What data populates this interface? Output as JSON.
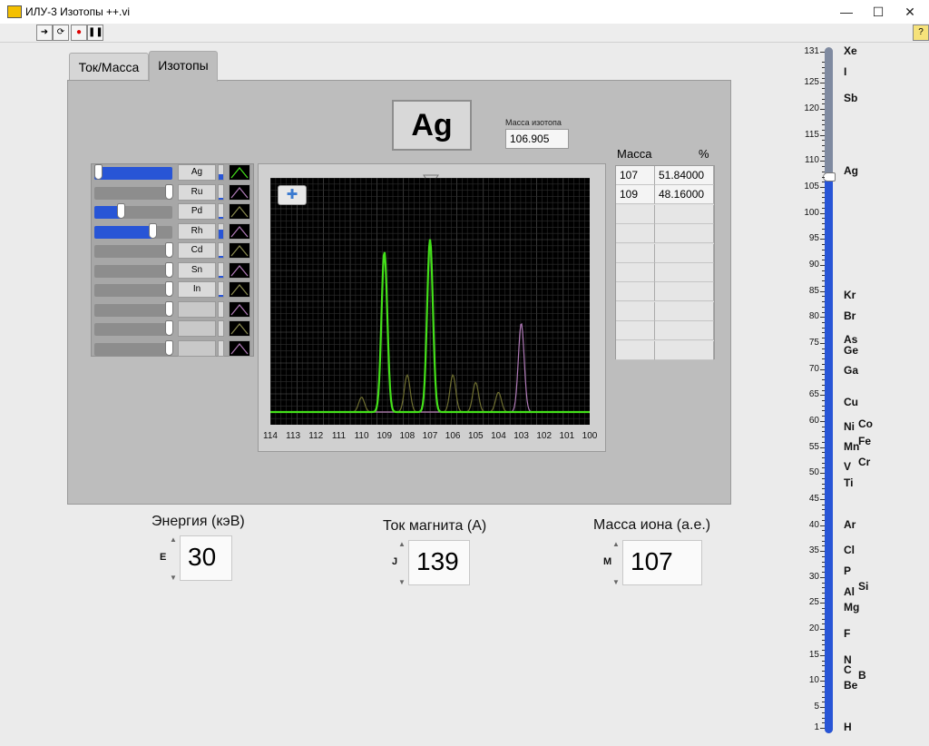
{
  "window": {
    "title": "ИЛУ-3 Изотопы ++.vi",
    "minimize": "—",
    "maximize": "☐",
    "close": "✕",
    "help": "?"
  },
  "tabs": [
    {
      "label": "Ток/Масса",
      "active": false
    },
    {
      "label": "Изотопы",
      "active": true
    }
  ],
  "element": {
    "symbol": "Ag",
    "mass_label": "Масса изотопа",
    "mass_value": "106.905"
  },
  "isotope_list": [
    {
      "label": "Ag",
      "level": 1.0,
      "bar": 0.4
    },
    {
      "label": "Ru",
      "level": 0.0,
      "bar": 0.1
    },
    {
      "label": "Pd",
      "level": 0.35,
      "bar": 0.1
    },
    {
      "label": "Rh",
      "level": 0.76,
      "bar": 0.6
    },
    {
      "label": "Cd",
      "level": 0.0,
      "bar": 0.1
    },
    {
      "label": "Sn",
      "level": 0.0,
      "bar": 0.1
    },
    {
      "label": "In",
      "level": 0.0,
      "bar": 0.1
    },
    {
      "label": "",
      "level": 0.0,
      "bar": 0
    },
    {
      "label": "",
      "level": 0.0,
      "bar": 0
    },
    {
      "label": "",
      "level": 0.0,
      "bar": 0
    }
  ],
  "chart_data": {
    "type": "line",
    "x": [
      114,
      113,
      112,
      111,
      110,
      109,
      108,
      107,
      106,
      105,
      104,
      103,
      102,
      101,
      100
    ],
    "xlim": [
      114,
      100
    ],
    "grid": true,
    "cursor_x": 107,
    "series": [
      {
        "color": "#44e01a",
        "peaks": [
          {
            "x": 109,
            "h": 0.65
          },
          {
            "x": 107,
            "h": 0.7
          }
        ]
      },
      {
        "color": "#6e6e30",
        "peaks": [
          {
            "x": 110,
            "h": 0.06
          },
          {
            "x": 108,
            "h": 0.15
          },
          {
            "x": 106,
            "h": 0.15
          },
          {
            "x": 105,
            "h": 0.12
          },
          {
            "x": 104,
            "h": 0.08
          }
        ]
      },
      {
        "color": "#b07ab8",
        "peaks": [
          {
            "x": 103,
            "h": 0.36
          }
        ]
      }
    ]
  },
  "table": {
    "headers": [
      "Масса",
      "%"
    ],
    "rows": [
      [
        "107",
        "51.84000"
      ],
      [
        "109",
        "48.16000"
      ]
    ],
    "empty_rows": 8
  },
  "controls": [
    {
      "label": "Энергия (кэВ)",
      "letter": "E",
      "value": "30"
    },
    {
      "label": "Ток магнита (А)",
      "letter": "J",
      "value": "139"
    },
    {
      "label": "Масса иона (а.е.)",
      "letter": "M",
      "value": "107"
    }
  ],
  "mass_scale": {
    "ticks": [
      "131",
      "125",
      "120",
      "115",
      "110",
      "105",
      "100",
      "95",
      "90",
      "85",
      "80",
      "75",
      "70",
      "65",
      "60",
      "55",
      "50",
      "45",
      "40",
      "35",
      "30",
      "25",
      "20",
      "15",
      "10",
      "5",
      "1"
    ],
    "min": 1,
    "max": 131,
    "value": 107,
    "elements": [
      {
        "s": "Xe",
        "m": 131
      },
      {
        "s": "I",
        "m": 127
      },
      {
        "s": "Sb",
        "m": 122
      },
      {
        "s": "Ag",
        "m": 108
      },
      {
        "s": "Kr",
        "m": 84
      },
      {
        "s": "Br",
        "m": 80
      },
      {
        "s": "As",
        "m": 75.5
      },
      {
        "s": "Ge",
        "m": 73.5
      },
      {
        "s": "Ga",
        "m": 69.5
      },
      {
        "s": "Cu",
        "m": 63.5
      },
      {
        "s": "Ni",
        "m": 58.7
      },
      {
        "s": "Co",
        "m": 59.2,
        "sup": true
      },
      {
        "s": "Mn",
        "m": 55
      },
      {
        "s": "Fe",
        "m": 56,
        "sup": true
      },
      {
        "s": "V",
        "m": 51
      },
      {
        "s": "Cr",
        "m": 52,
        "sup": true
      },
      {
        "s": "Ti",
        "m": 48
      },
      {
        "s": "Ar",
        "m": 40
      },
      {
        "s": "Cl",
        "m": 35
      },
      {
        "s": "P",
        "m": 31
      },
      {
        "s": "Si",
        "m": 28,
        "sup": true
      },
      {
        "s": "Al",
        "m": 27
      },
      {
        "s": "Mg",
        "m": 24
      },
      {
        "s": "F",
        "m": 19
      },
      {
        "s": "N",
        "m": 14
      },
      {
        "s": "C",
        "m": 12
      },
      {
        "s": "B",
        "m": 11,
        "sup": true
      },
      {
        "s": "Be",
        "m": 9
      },
      {
        "s": "H",
        "m": 1
      }
    ]
  }
}
